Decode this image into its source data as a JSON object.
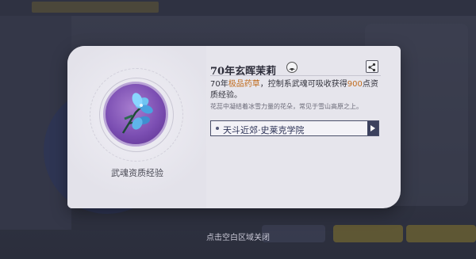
{
  "item": {
    "title": "70年玄晖茉莉",
    "icon_caption": "武魂资质经验",
    "description": {
      "part1": "70年",
      "quality": "极品药草",
      "part2": "，控制系武魂可吸收获得",
      "amount": "900",
      "part3": "点资质经验。"
    },
    "flavor_text": "花蕊中凝结着冰雪力量的花朵，常见于雪山高原之上。",
    "source": "天斗近郊·史莱克学院"
  },
  "footer": {
    "close_hint": "点击空白区域关闭"
  },
  "colors": {
    "highlight": "#c06b1d",
    "card_bg": "#e6e5ec",
    "source_border": "#4a4f6a"
  },
  "icons": {
    "type_badge": "swallow-emblem-icon",
    "share": "share-icon",
    "item": "jasmine-flower-icon",
    "source_arrow": "play-arrow-icon"
  }
}
